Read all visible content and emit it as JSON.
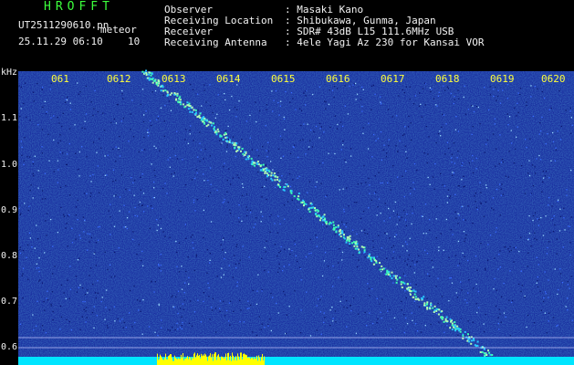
{
  "header": {
    "app_title": "HROFFT",
    "file_name": "UT2511290610.pn",
    "mode": "meteor",
    "date_time": "25.11.29 06:10",
    "interval": "10"
  },
  "meta": [
    {
      "label": "Observer",
      "value": ": Masaki Kano"
    },
    {
      "label": "Receiving Location",
      "value": ": Shibukawa, Gunma, Japan"
    },
    {
      "label": "Receiver",
      "value": ": SDR# 43dB L15 111.6MHz USB"
    },
    {
      "label": "Receiving Antenna",
      "value": ": 4ele Yagi Az 230 for Kansai VOR"
    }
  ],
  "waterfall": {
    "frequency_unit": "kHz",
    "frequency_ticks": [
      "1.1",
      "1.0",
      "0.9",
      "0.8",
      "0.7",
      "0.6"
    ],
    "time_ticks": [
      "061",
      "0612",
      "0613",
      "0614",
      "0615",
      "0616",
      "0617",
      "0618",
      "0619",
      "0620"
    ],
    "colors": {
      "background": "#1a2fa0",
      "trace": "#3cffb4",
      "text_green": "#3cff3c",
      "text_yellow": "#ffff3c",
      "level_bar": "#00e5ff",
      "level_peak": "#ffff00"
    }
  }
}
